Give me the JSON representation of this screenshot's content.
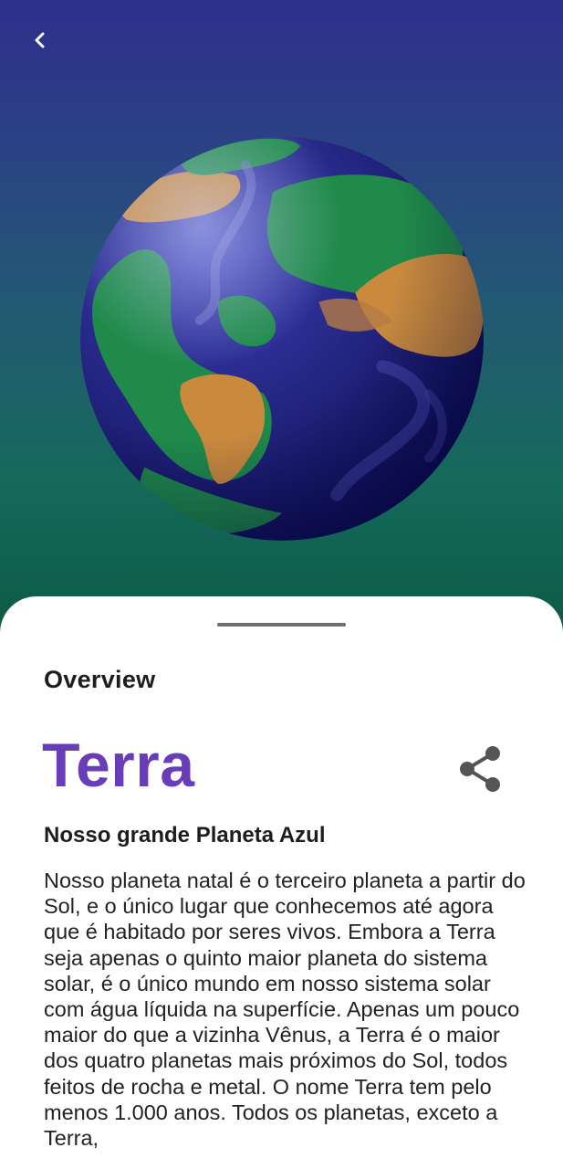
{
  "header": {
    "back_icon": "chevron-left-icon",
    "planet_illustration": "earth-illustration"
  },
  "sheet": {
    "section_label": "Overview",
    "title": "Terra",
    "share_icon": "share-icon",
    "subtitle": "Nosso grande Planeta Azul",
    "description": "Nosso planeta natal é o terceiro planeta a partir do Sol, e o único lugar que conhecemos até agora que é habitado por seres vivos. Embora a Terra seja apenas o quinto maior planeta do sistema solar, é o único mundo em nosso sistema solar com água líquida na superfície. Apenas um pouco maior do que a vizinha Vênus, a Terra é o maior dos quatro planetas mais próximos do Sol, todos feitos de rocha e metal. O nome Terra tem pelo menos 1.000 anos. Todos os planetas, exceto a Terra,"
  },
  "colors": {
    "title_color": "#6a3db8",
    "hero_top": "#2f2f8c",
    "hero_bottom": "#0b5a44"
  }
}
